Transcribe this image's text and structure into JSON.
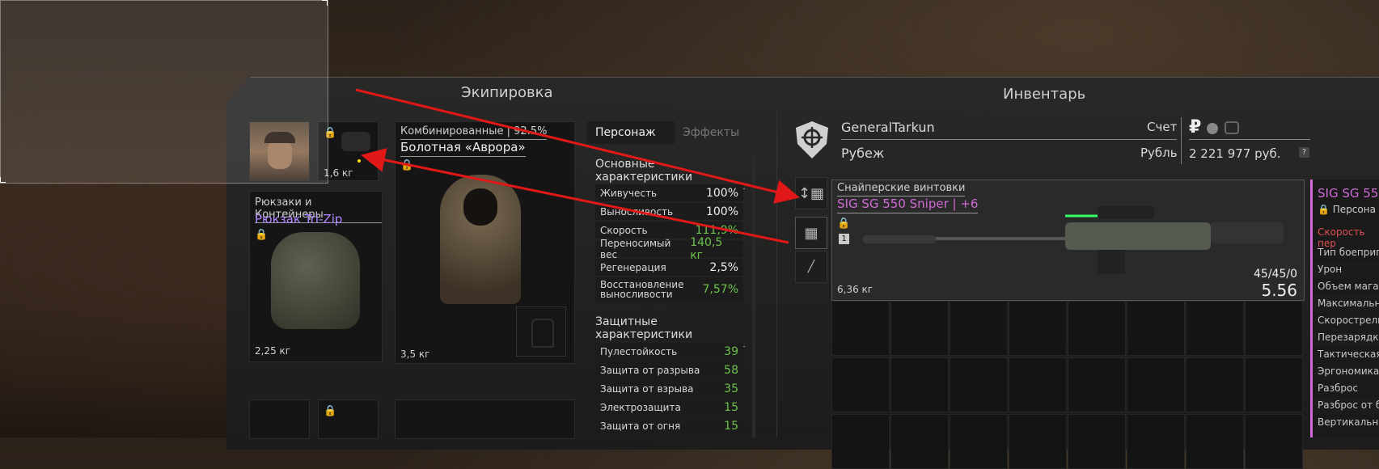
{
  "equipment": {
    "title": "Экипировка",
    "helmet": {
      "weight": "1,6 кг"
    },
    "backpack": {
      "category": "Рюкзаки и Контейнеры",
      "name": "Рюкзак Tri-Zip",
      "weight": "2,25 кг"
    },
    "armor": {
      "category": "Комбинированные | 92.5%",
      "name": "Болотная «Аврора»",
      "weight": "3,5 кг"
    }
  },
  "tabs": {
    "character": "Персонаж",
    "effects": "Эффекты"
  },
  "main_stats": {
    "title": "Основные характеристики",
    "rows": [
      {
        "label": "Живучесть",
        "value": "100%",
        "color": "white"
      },
      {
        "label": "Выносливость",
        "value": "100%",
        "color": "white"
      },
      {
        "label": "Скорость",
        "value": "111,9%",
        "color": "green"
      },
      {
        "label": "Переносимый вес",
        "value": "140,5 кг",
        "color": "green"
      },
      {
        "label": "Регенерация",
        "value": "2,5%",
        "color": "white"
      },
      {
        "label": "Восстановление выносливости",
        "value": "7,57%",
        "color": "green"
      }
    ]
  },
  "protection_stats": {
    "title": "Защитные характеристики",
    "rows": [
      {
        "label": "Пулестойкость",
        "value": "39"
      },
      {
        "label": "Защита от разрыва",
        "value": "58"
      },
      {
        "label": "Защита от взрыва",
        "value": "35"
      },
      {
        "label": "Электрозащита",
        "value": "15"
      },
      {
        "label": "Защита от огня",
        "value": "15"
      }
    ]
  },
  "inventory": {
    "title": "Инвентарь",
    "player_name": "GeneralTarkun",
    "location": "Рубеж",
    "account_label": "Счет",
    "currency_label": "Рубль",
    "balance": "2 221 977 руб.",
    "currency_symbol": "₽",
    "help": "?"
  },
  "weapon": {
    "category": "Снайперские винтовки",
    "name": "SIG SG 550 Sniper  | +6",
    "weight": "6,36 кг",
    "ammo": "45/45/0",
    "caliber": "5.56",
    "slot_number": "1"
  },
  "right_panel": {
    "title": "SIG SG 55",
    "subtitle": "Персона",
    "speed": "Скорость пер",
    "rows": [
      "Тип боеприп",
      "Урон",
      "Объем магаз",
      "Максимальн",
      "Скорострель",
      "Перезарядка",
      "Тактическая",
      "Эргономика",
      "Разброс",
      "Разброс от б",
      "Вертикальн"
    ]
  }
}
